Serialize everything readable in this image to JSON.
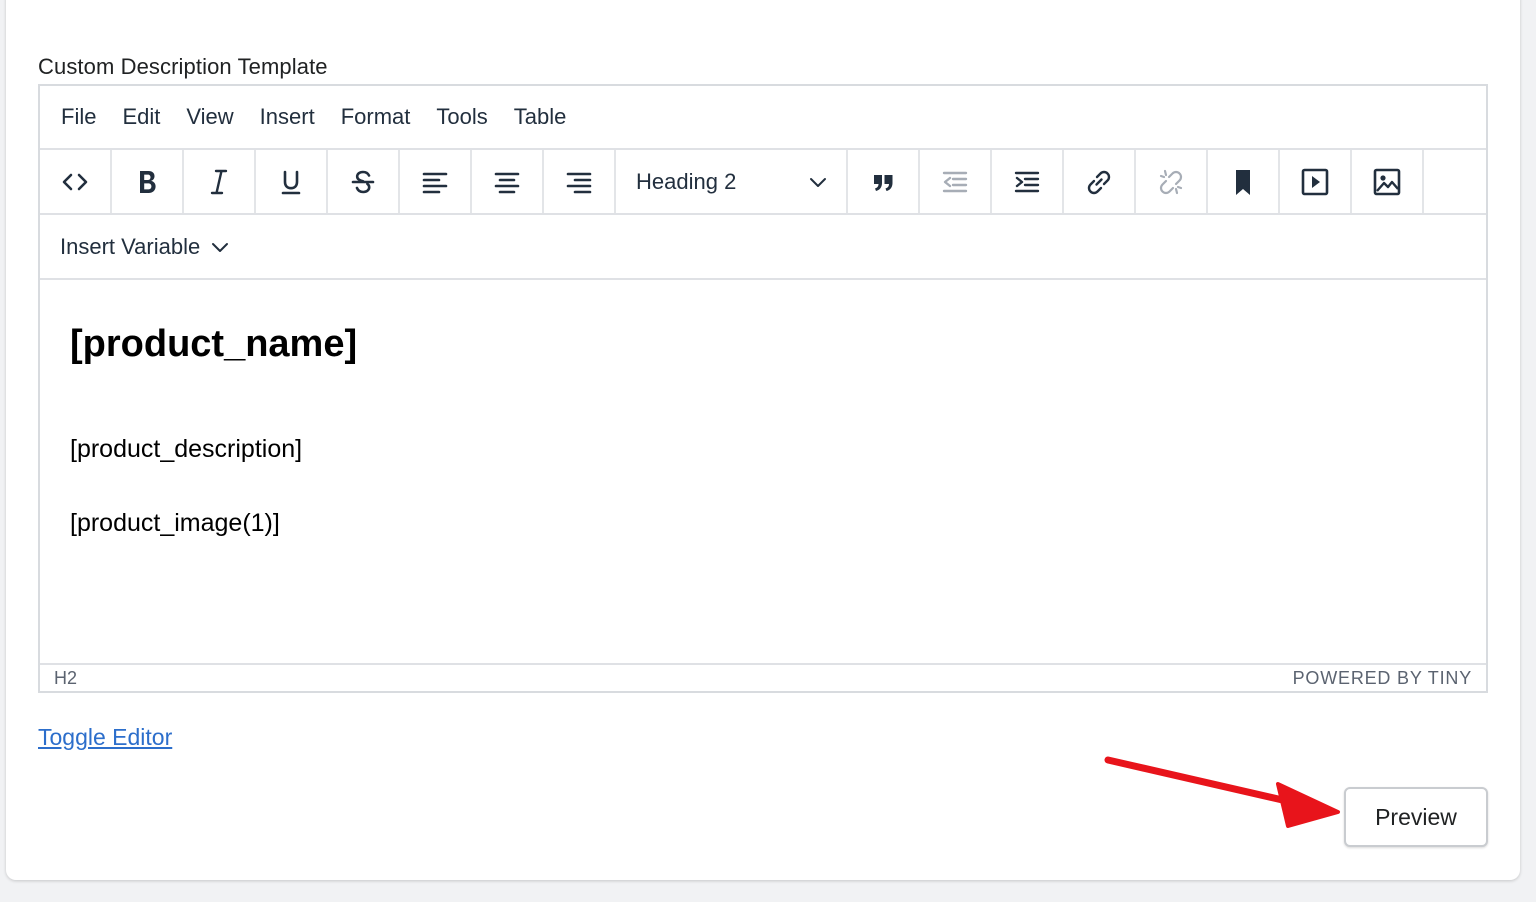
{
  "field_label": "Custom Description Template",
  "menubar": [
    "File",
    "Edit",
    "View",
    "Insert",
    "Format",
    "Tools",
    "Table"
  ],
  "toolbar": {
    "block_format": "Heading 2",
    "insert_variable": "Insert Variable"
  },
  "content": {
    "heading": "[product_name]",
    "paragraphs": [
      "[product_description]",
      "[product_image(1)]"
    ]
  },
  "statusbar": {
    "path": "H2",
    "branding": "POWERED BY TINY"
  },
  "toggle_editor": "Toggle Editor",
  "preview_button": "Preview",
  "colors": {
    "link": "#2c6ecb",
    "annotation_arrow": "#e8141b",
    "icon": "#222f3e",
    "icon_disabled": "#a7adb6"
  }
}
